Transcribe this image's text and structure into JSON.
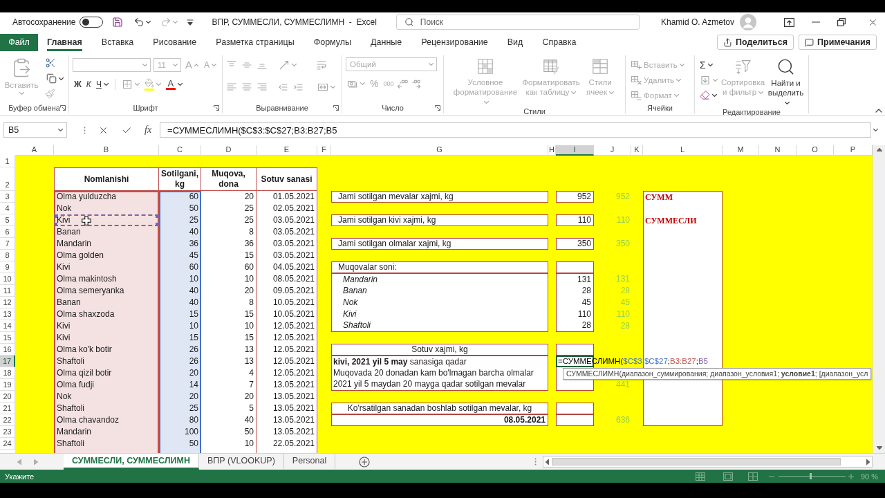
{
  "title_bar": {
    "autosave_label": "Автосохранение",
    "autosave_on": false,
    "title": "ВПР, СУММЕСЛИ, СУММЕСЛИМН  -  Excel",
    "search": {
      "placeholder": "Поиск"
    },
    "user": "Khamid O. Azmetov"
  },
  "ribbon_tabs": [
    {
      "label": "Файл",
      "kind": "file",
      "selected": false
    },
    {
      "label": "Главная",
      "kind": "tab",
      "selected": true
    },
    {
      "label": "Вставка",
      "kind": "tab",
      "selected": false
    },
    {
      "label": "Рисование",
      "kind": "tab",
      "selected": false
    },
    {
      "label": "Разметка страницы",
      "kind": "tab",
      "selected": false
    },
    {
      "label": "Формулы",
      "kind": "tab",
      "selected": false
    },
    {
      "label": "Данные",
      "kind": "tab",
      "selected": false
    },
    {
      "label": "Рецензирование",
      "kind": "tab",
      "selected": false
    },
    {
      "label": "Вид",
      "kind": "tab",
      "selected": false
    },
    {
      "label": "Справка",
      "kind": "tab",
      "selected": false
    }
  ],
  "ribbon_buttons": [
    {
      "label": "Поделиться"
    },
    {
      "label": "Примечания"
    }
  ],
  "ribbon": {
    "groups": [
      {
        "label": "Буфер обмена",
        "launcher": true,
        "commands": [
          {
            "label": "Вставить",
            "disabled": true
          },
          {
            "disabled": false
          },
          {
            "disabled": false
          },
          {
            "disabled": true
          }
        ]
      },
      {
        "label": "Шрифт",
        "launcher": true,
        "commands": [
          {
            "disabled": true
          },
          {
            "value": "11",
            "disabled": true
          },
          {
            "glyph": "A",
            "disabled": true
          },
          {
            "glyph": "A",
            "disabled": true
          },
          {
            "glyph": "Ж",
            "disabled": false
          },
          {
            "glyph": "К",
            "disabled": false
          },
          {
            "glyph": "Ч",
            "disabled": false
          },
          {
            "disabled": true
          },
          {
            "color": "#ffff00",
            "disabled": true
          },
          {
            "glyph": "A",
            "color": "#ff0000",
            "disabled": false
          }
        ]
      },
      {
        "label": "Выравнивание",
        "launcher": true,
        "commands": [
          {
            "disabled": true
          },
          {
            "disabled": true
          },
          {
            "disabled": true
          },
          {
            "disabled": true
          },
          {
            "disabled": true
          },
          {
            "disabled": true
          },
          {
            "disabled": true
          },
          {
            "disabled": true
          },
          {
            "disabled": true
          },
          {
            "disabled": true
          },
          {
            "disabled": true
          }
        ]
      },
      {
        "label": "Число",
        "launcher": true,
        "commands": [
          {
            "value": "Общий",
            "disabled": true
          },
          {
            "disabled": true
          },
          {
            "glyph": "%",
            "disabled": true
          },
          {
            "glyph": "000",
            "disabled": true
          },
          {
            "disabled": true
          },
          {
            "disabled": true
          }
        ]
      },
      {
        "label": "Стили",
        "launcher": false,
        "commands": [
          {
            "label": "Условное форматирование",
            "disabled": true
          },
          {
            "label": "Форматировать как таблицу",
            "disabled": true
          },
          {
            "label": "Стили ячеек",
            "disabled": true
          }
        ]
      },
      {
        "label": "Ячейки",
        "launcher": false,
        "commands": [
          {
            "label": "Вставить",
            "disabled": true
          },
          {
            "label": "Удалить",
            "disabled": true
          },
          {
            "label": "Формат",
            "disabled": true
          }
        ]
      },
      {
        "label": "Редактирование",
        "launcher": false,
        "commands": [
          {
            "glyph": "Σ",
            "disabled": false
          },
          {
            "disabled": true
          },
          {
            "disabled": false
          },
          {
            "label": "Сортировка и фильтр",
            "disabled": true
          },
          {
            "label": "Найти и выделить",
            "disabled": false
          }
        ]
      }
    ]
  },
  "formula_bar": {
    "name_box": "B5",
    "fx": "fx",
    "formula": "=СУММЕСЛИМН($C$3:$C$27;B3:B27;B5"
  },
  "columns": [
    {
      "label": "A",
      "selected": false
    },
    {
      "label": "B",
      "selected": false
    },
    {
      "label": "C",
      "selected": false
    },
    {
      "label": "D",
      "selected": false
    },
    {
      "label": "E",
      "selected": false
    },
    {
      "label": "F",
      "selected": false
    },
    {
      "label": "G",
      "selected": false
    },
    {
      "label": "H",
      "selected": false
    },
    {
      "label": "I",
      "selected": true
    },
    {
      "label": "J",
      "selected": false
    },
    {
      "label": "K",
      "selected": false
    },
    {
      "label": "L",
      "selected": false
    },
    {
      "label": "M",
      "selected": false
    },
    {
      "label": "N",
      "selected": false
    },
    {
      "label": "O",
      "selected": false
    },
    {
      "label": "P",
      "selected": false
    }
  ],
  "row_numbers": [
    {
      "label": "1",
      "selected": false
    },
    {
      "label": "2",
      "selected": false
    },
    {
      "label": "3",
      "selected": false
    },
    {
      "label": "4",
      "selected": false
    },
    {
      "label": "5",
      "selected": false
    },
    {
      "label": "6",
      "selected": false
    },
    {
      "label": "7",
      "selected": false
    },
    {
      "label": "8",
      "selected": false
    },
    {
      "label": "9",
      "selected": false
    },
    {
      "label": "10",
      "selected": false
    },
    {
      "label": "11",
      "selected": false
    },
    {
      "label": "12",
      "selected": false
    },
    {
      "label": "13",
      "selected": false
    },
    {
      "label": "14",
      "selected": false
    },
    {
      "label": "15",
      "selected": false
    },
    {
      "label": "16",
      "selected": false
    },
    {
      "label": "17",
      "selected": true
    },
    {
      "label": "18",
      "selected": false
    },
    {
      "label": "19",
      "selected": false
    },
    {
      "label": "20",
      "selected": false
    },
    {
      "label": "21",
      "selected": false
    },
    {
      "label": "22",
      "selected": false
    },
    {
      "label": "23",
      "selected": false
    },
    {
      "label": "24",
      "selected": false
    }
  ],
  "table": {
    "headers": [
      {
        "label": "Nomlanishi",
        "color": "#c0504d"
      },
      {
        "label": "Sotilgani, kg",
        "color": "#4472c4"
      },
      {
        "label": "Muqova, dona"
      },
      {
        "label": "Sotuv sanasi"
      }
    ],
    "rows": [
      {
        "name": "Olma yulduzcha",
        "sold": "60",
        "covers": "20",
        "date": "01.05.2021",
        "referenced": false
      },
      {
        "name": "Nok",
        "sold": "50",
        "covers": "25",
        "date": "02.05.2021",
        "referenced": false
      },
      {
        "name": "Kivi",
        "sold": "25",
        "covers": "25",
        "date": "03.05.2021",
        "referenced": true
      },
      {
        "name": "Banan",
        "sold": "40",
        "covers": "8",
        "date": "03.05.2021",
        "referenced": false
      },
      {
        "name": "Mandarin",
        "sold": "36",
        "covers": "36",
        "date": "03.05.2021",
        "referenced": false
      },
      {
        "name": "Olma golden",
        "sold": "45",
        "covers": "15",
        "date": "03.05.2021",
        "referenced": false
      },
      {
        "name": "Kivi",
        "sold": "60",
        "covers": "60",
        "date": "04.05.2021",
        "referenced": false
      },
      {
        "name": "Olma makintosh",
        "sold": "10",
        "covers": "10",
        "date": "08.05.2021",
        "referenced": false
      },
      {
        "name": "Olma semeryanka",
        "sold": "40",
        "covers": "20",
        "date": "09.05.2021",
        "referenced": false
      },
      {
        "name": "Banan",
        "sold": "40",
        "covers": "8",
        "date": "10.05.2021",
        "referenced": false
      },
      {
        "name": "Olma shaxzoda",
        "sold": "15",
        "covers": "15",
        "date": "10.05.2021",
        "referenced": false
      },
      {
        "name": "Kivi",
        "sold": "10",
        "covers": "10",
        "date": "12.05.2021",
        "referenced": false
      },
      {
        "name": "Kivi",
        "sold": "15",
        "covers": "15",
        "date": "12.05.2021",
        "referenced": false
      },
      {
        "name": "Olma ko'k botir",
        "sold": "26",
        "covers": "13",
        "date": "12.05.2021",
        "referenced": false
      },
      {
        "name": "Shaftoli",
        "sold": "26",
        "covers": "13",
        "date": "12.05.2021",
        "referenced": false
      },
      {
        "name": "Olma qizil botir",
        "sold": "20",
        "covers": "4",
        "date": "12.05.2021",
        "referenced": false
      },
      {
        "name": "Olma fudji",
        "sold": "14",
        "covers": "7",
        "date": "13.05.2021",
        "referenced": false
      },
      {
        "name": "Nok",
        "sold": "20",
        "covers": "20",
        "date": "13.05.2021",
        "referenced": false
      },
      {
        "name": "Shaftoli",
        "sold": "25",
        "covers": "5",
        "date": "13.05.2021",
        "referenced": false
      },
      {
        "name": "Olma chavandoz",
        "sold": "80",
        "covers": "40",
        "date": "13.05.2021",
        "referenced": false
      },
      {
        "name": "Mandarin",
        "sold": "100",
        "covers": "50",
        "date": "13.05.2021",
        "referenced": false
      },
      {
        "name": "Shaftoli",
        "sold": "50",
        "covers": "10",
        "date": "22.05.2021",
        "referenced": false
      }
    ]
  },
  "summary": [
    {
      "kind": "single",
      "label": "Jami sotilgan mevalar xajmi, kg",
      "value": "952",
      "check": "952"
    },
    {
      "kind": "single",
      "label": "Jami sotilgan kivi xajmi, kg",
      "value": "110",
      "check": "110"
    },
    {
      "kind": "single",
      "label": "Jami sotilgan olmalar xajmi, kg",
      "value": "350",
      "check": "350"
    },
    {
      "kind": "list",
      "label": "Muqovalar soni:",
      "items": [
        {
          "label": "Mandarin",
          "value": "131",
          "check": "131"
        },
        {
          "label": "Banan",
          "value": "28",
          "check": "28"
        },
        {
          "label": "Nok",
          "value": "45",
          "check": "45"
        },
        {
          "label": "Kivi",
          "value": "110",
          "check": "110"
        },
        {
          "label": "Shaftoli",
          "value": "28",
          "check": "28"
        }
      ]
    },
    {
      "kind": "criteria",
      "label": "Sotuv xajmi, kg",
      "items": [
        {
          "label": "**kivi, 2021 yil 5 may** sanasiga qadar",
          "editor": {
            "segments": [
              {
                "text": "=СУММЕСЛИМН("
              },
              {
                "text": "$C$3:$C$27",
                "color": "#4472c4"
              },
              {
                "text": ";"
              },
              {
                "text": "B3:B27",
                "color": "#c0504d"
              },
              {
                "text": ";"
              },
              {
                "text": "B5",
                "color": "#8064a2"
              }
            ],
            "tooltip": "СУММЕСЛИМН(диапазон_суммирования; диапазон_условия1; **условие1**; [диапазон_усл"
          }
        },
        {
          "label": "Muqovada 20 donadan kam bo'lmagan barcha olmalar"
        },
        {
          "label": "2021 yil 5 maydan 20 mayga qadar sotilgan mevalar",
          "check": "441"
        }
      ]
    },
    {
      "kind": "dated",
      "label": "Ko'rsatilgan sanadan boshlab sotilgan mevalar, kg",
      "date": "08.05.2021",
      "check": "636"
    }
  ],
  "notes": [
    {
      "text": "СУММ"
    },
    {
      "text": "СУММЕСЛИ"
    }
  ],
  "sheet_tabs": [
    {
      "label": "СУММЕСЛИ, СУММЕСЛИМН",
      "selected": true
    },
    {
      "label": "ВПР (VLOOKUP)",
      "selected": false
    },
    {
      "label": "Personal",
      "selected": false
    }
  ],
  "status_bar": {
    "mode": "Укажите",
    "zoom_label": "90 %",
    "zoom_slider": {
      "level": 0.48
    }
  }
}
